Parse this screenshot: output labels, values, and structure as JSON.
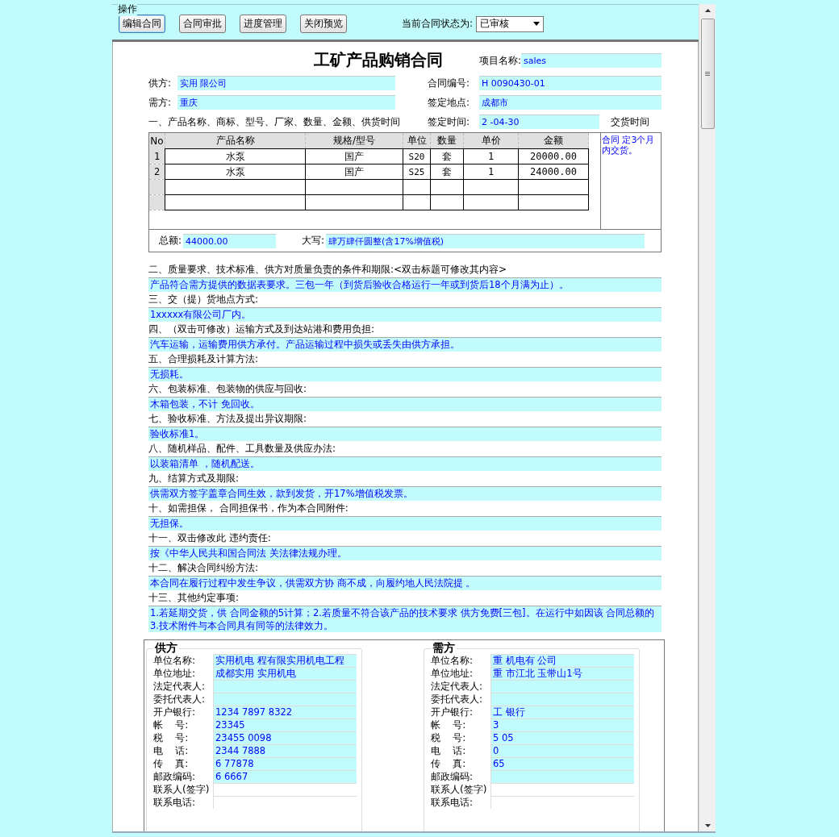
{
  "toolbar": {
    "legend": "操作",
    "buttons": [
      {
        "label": "编辑合同",
        "focused": true
      },
      {
        "label": "合同审批",
        "focused": false
      },
      {
        "label": "进度管理",
        "focused": false
      },
      {
        "label": "关闭预览",
        "focused": false
      }
    ],
    "status_label": "当前合同状态为:",
    "status_select": {
      "value": "已审核"
    }
  },
  "document": {
    "title": "工矿产品购销合同",
    "project_name": {
      "label": "项目名称:",
      "value": "sales"
    },
    "supplier": {
      "label": "供方:",
      "value": "实用 限公司"
    },
    "contract_no": {
      "label": "合同编号:",
      "value": "H 0090430-01"
    },
    "buyer": {
      "label": "需方:",
      "value": "重庆"
    },
    "sign_place": {
      "label": "签定地点:",
      "value": "成都市"
    },
    "section_1_heading": "一、产品名称、商标、型号、厂家、数量、金额、供货时间",
    "sign_date": {
      "label": "签定时间:",
      "value": "2 -04-30"
    },
    "delivery_time": {
      "label": "交货时间",
      "value": "合同 定3个月内交货。"
    },
    "product_table": {
      "columns": [
        "No",
        "产品名称",
        "规格/型号",
        "单位",
        "数量",
        "单价",
        "金额"
      ],
      "rows": [
        {
          "cells": [
            "1",
            "水泵",
            "国产",
            "S20",
            "套",
            "1",
            "20000.00"
          ]
        },
        {
          "cells": [
            "2",
            "水泵",
            "国产",
            "S25",
            "套",
            "1",
            "24000.00"
          ]
        }
      ]
    },
    "total": {
      "label": "总额:",
      "value": "44000.00"
    },
    "amount_in_words": {
      "label": "大写:",
      "value": "肆万肆仟圆整(含17%增值税)"
    },
    "clauses": [
      {
        "heading": "二、质量要求、技术标准、供方对质量负责的条件和期限:<双击标题可修改其内容>",
        "value": "产品符合需方提供的数据表要求。三包一年（到货后验收合格运行一年或到货后18个月满为止）。"
      },
      {
        "heading": "三、交（提）货地点方式:",
        "value": "1xxxxx有限公司厂内。"
      },
      {
        "heading": "四、（双击可修改）运输方式及到达站港和费用负担:",
        "value": "汽车运输，运输费用供方承付。产品运输过程中损失或丢失由供方承担。"
      },
      {
        "heading": "五、合理损耗及计算方法:",
        "value": "无损耗。"
      },
      {
        "heading": "六、包装标准、包装物的供应与回收:",
        "value": "木箱包装，不计 免回收。"
      },
      {
        "heading": "七、验收标准、方法及提出异议期限:",
        "value": "验收标准1。"
      },
      {
        "heading": "八、随机样品、配件、工具数量及供应办法:",
        "value": "以装箱清单 ，随机配送。"
      },
      {
        "heading": "九、结算方式及期限:",
        "value": "供需双方签字盖章合同生效，款到发货，开17%增值税发票。"
      },
      {
        "heading": "十、如需担保， 合同担保书，作为本合同附件:",
        "value": "无担保。"
      },
      {
        "heading": "十一、双击修改此 违约责任:",
        "value": "按《中华人民共和国合同法 关法律法规办理。"
      },
      {
        "heading": "十二、解决合同纠纷方法:",
        "value": "本合同在履行过程中发生争议，供需双方协 商不成，向履约地人民法院提 。"
      },
      {
        "heading": "十三、其他约定事项:",
        "value": "1.若延期交货，供 合同金额的5计算；2.若质量不符合该产品的技术要求 供方免费[三包]。在运行中如因该 合同总额的 3.技术附件与本合同具有同等的法律效力。"
      }
    ],
    "parties": [
      {
        "legend": "供方",
        "fields": [
          {
            "label": "单位名称:",
            "value": "实用机电 程有限实用机电工程",
            "editable": true
          },
          {
            "label": "单位地址:",
            "value": "成都实用 实用机电",
            "editable": true
          },
          {
            "label": "法定代表人:",
            "editable": true
          },
          {
            "label": "委托代表人:",
            "editable": true
          },
          {
            "label": "开户银行:",
            "value": "1234 7897 8322",
            "editable": true
          },
          {
            "label": "帐    号:",
            "value": "23345",
            "editable": true
          },
          {
            "label": "税    号:",
            "value": "23455 0098",
            "editable": true
          },
          {
            "label": "电    话:",
            "value": "2344 7888",
            "editable": true
          },
          {
            "label": "传    真:",
            "value": "6 77878",
            "editable": true
          },
          {
            "label": "邮政编码:",
            "value": "6 6667",
            "editable": true
          },
          {
            "label": "联系人(签字)",
            "editable": false
          },
          {
            "label": "联系电话:",
            "editable": false
          }
        ]
      },
      {
        "legend": "需方",
        "fields": [
          {
            "label": "单位名称:",
            "value": "重 机电有 公司",
            "editable": true
          },
          {
            "label": "单位地址:",
            "value": "重 市江北 玉带山1号",
            "editable": true
          },
          {
            "label": "法定代表人:",
            "editable": true
          },
          {
            "label": "委托代表人:",
            "editable": true
          },
          {
            "label": "开户银行:",
            "value": "工 银行",
            "editable": true
          },
          {
            "label": "帐    号:",
            "value": "3",
            "editable": true
          },
          {
            "label": "税    号:",
            "value": "5 05",
            "editable": true
          },
          {
            "label": "电    话:",
            "value": "0",
            "editable": true
          },
          {
            "label": "传    真:",
            "value": "65",
            "editable": true
          },
          {
            "label": "邮政编码:",
            "editable": true
          },
          {
            "label": "联系人(签字)",
            "editable": false
          },
          {
            "label": "联系电话:",
            "editable": false
          }
        ]
      }
    ]
  }
}
